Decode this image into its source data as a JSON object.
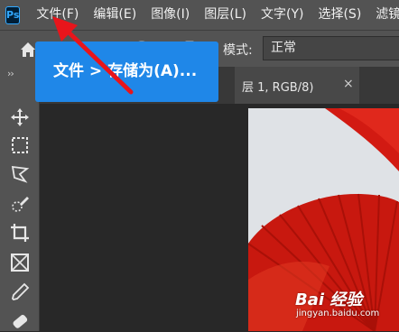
{
  "app": {
    "logo_text": "Ps"
  },
  "menu": [
    {
      "label": "文件(F)"
    },
    {
      "label": "编辑(E)"
    },
    {
      "label": "图像(I)"
    },
    {
      "label": "图层(L)"
    },
    {
      "label": "文字(Y)"
    },
    {
      "label": "选择(S)"
    },
    {
      "label": "滤镜"
    }
  ],
  "options_bar": {
    "mode_label": "模式:",
    "mode_value": "正常"
  },
  "toolbar": {
    "collapse": "››"
  },
  "document_tab": {
    "title_fragment": "层 1, RGB/8)",
    "close": "×"
  },
  "tooltip": {
    "text": "文件 > 存储为(A)..."
  },
  "watermark": {
    "logo_text": "Bai 经验",
    "url": "jingyan.baidu.com"
  },
  "colors": {
    "accent": "#1f87e8",
    "arrow": "#e8151b",
    "menu_bg": "#535353",
    "canvas_bg": "#282828"
  }
}
